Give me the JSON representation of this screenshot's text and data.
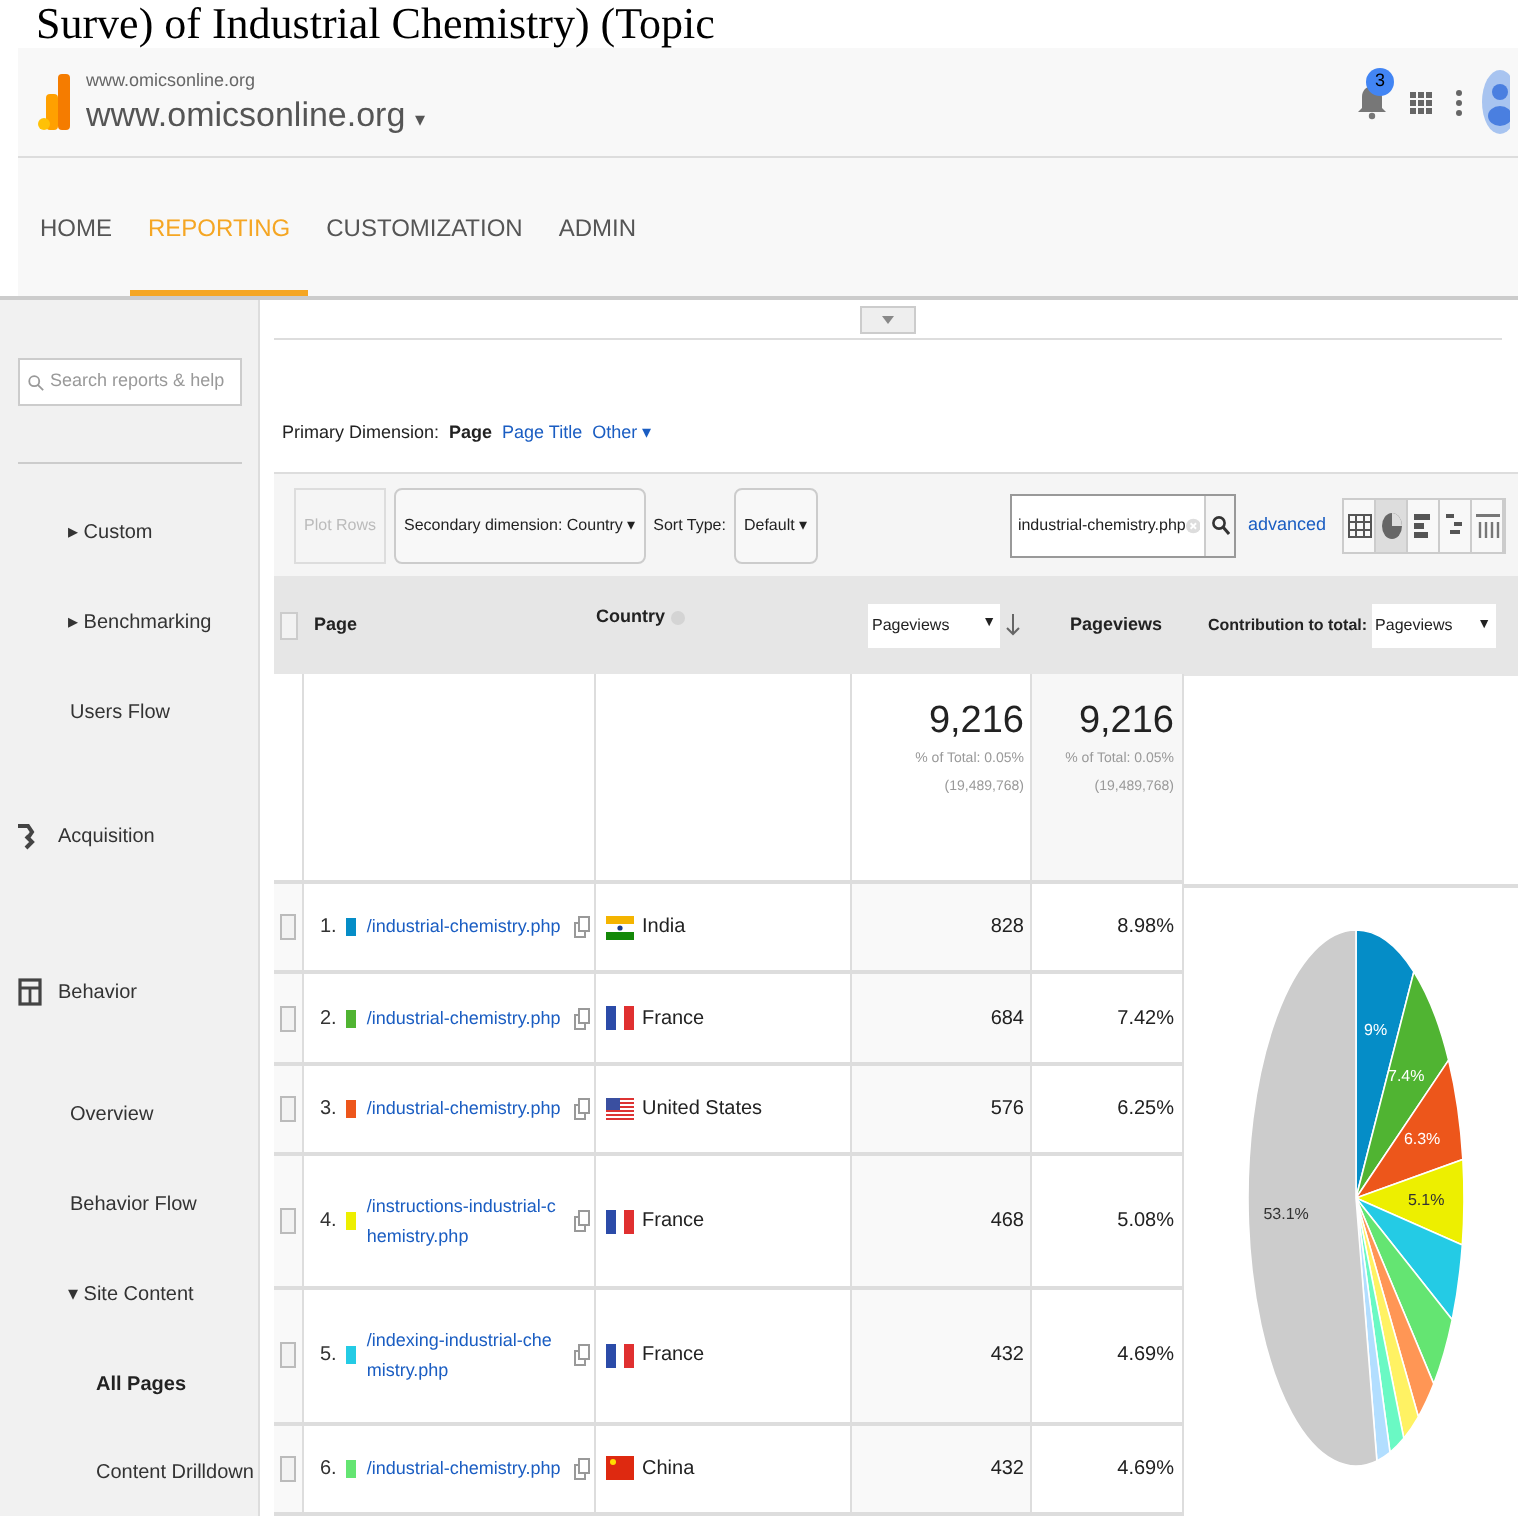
{
  "banner": {
    "title": "Surve) of Industrial Chemistry) (Topic"
  },
  "header": {
    "account": "www.omicsonline.org",
    "property": "www.omicsonline.org",
    "property_caret": "▾",
    "notifications": "3"
  },
  "nav": [
    {
      "label": "HOME",
      "selected": false
    },
    {
      "label": "REPORTING",
      "selected": true
    },
    {
      "label": "CUSTOMIZATION",
      "selected": false
    },
    {
      "label": "ADMIN",
      "selected": false
    }
  ],
  "sidebar": {
    "search_placeholder": "Search reports & help",
    "items": [
      {
        "kind": "expandable",
        "label": "Custom",
        "caret": "▸"
      },
      {
        "kind": "expandable",
        "label": "Benchmarking",
        "caret": "▸"
      },
      {
        "kind": "link",
        "label": "Users Flow",
        "selected": false
      },
      {
        "kind": "section",
        "label": "Acquisition"
      },
      {
        "kind": "section",
        "label": "Behavior"
      },
      {
        "kind": "link",
        "label": "Overview",
        "selected": false
      },
      {
        "kind": "link",
        "label": "Behavior Flow",
        "selected": false
      },
      {
        "kind": "expandable",
        "label": "Site Content",
        "caret": "▾"
      },
      {
        "kind": "sublink",
        "label": "All Pages",
        "selected": true
      },
      {
        "kind": "sublink",
        "label": "Content Drilldown",
        "selected": false
      }
    ]
  },
  "primary_dimension": {
    "label": "Primary Dimension:",
    "options": [
      {
        "label": "Page",
        "selected": true
      },
      {
        "label": "Page Title",
        "selected": false
      },
      {
        "label": "Other ▾",
        "selected": false
      }
    ]
  },
  "toolbar": {
    "plot_rows": {
      "label": "Plot Rows",
      "disabled": true
    },
    "secondary": "Secondary dimension: Country",
    "secondary_caret": "▾",
    "sort_label": "Sort Type:",
    "sort_value": "Default",
    "sort_caret": "▾",
    "filter_value": "industrial-chemistry.php",
    "advanced": "advanced",
    "views": [
      {
        "kind": "table",
        "selected": false
      },
      {
        "kind": "pie",
        "selected": true
      },
      {
        "kind": "performance",
        "selected": false
      },
      {
        "kind": "comparison",
        "selected": false
      },
      {
        "kind": "pivot",
        "selected": false
      }
    ]
  },
  "table": {
    "select_all_checked": false,
    "columns": {
      "page": "Page",
      "country": "Country",
      "metric_select": "Pageviews",
      "metric_select_caret": "▼",
      "metric": "Pageviews",
      "contribution_label": "Contribution to total:",
      "contribution_select": "Pageviews",
      "contribution_caret": "▼"
    },
    "totals": [
      {
        "value": "9,216",
        "share": "% of Total: 0.05%",
        "total": "(19,489,768)"
      },
      {
        "value": "9,216",
        "share": "% of Total: 0.05%",
        "total": "(19,489,768)"
      }
    ],
    "rows": [
      {
        "checked": false,
        "index": "1.",
        "color": "#058dc7",
        "page": "/industrial-chemistry.php",
        "country": {
          "name": "India",
          "kind": "india"
        },
        "pageviews": "828",
        "share": "8.98%"
      },
      {
        "checked": false,
        "index": "2.",
        "color": "#50b432",
        "page": "/industrial-chemistry.php",
        "country": {
          "name": "France",
          "kind": "france"
        },
        "pageviews": "684",
        "share": "7.42%"
      },
      {
        "checked": false,
        "index": "3.",
        "color": "#ed561b",
        "page": "/industrial-chemistry.php",
        "country": {
          "name": "United States",
          "kind": "usa"
        },
        "pageviews": "576",
        "share": "6.25%"
      },
      {
        "checked": false,
        "index": "4.",
        "color": "#edef00",
        "page": "/instructions-industrial-chemistry.php",
        "country": {
          "name": "France",
          "kind": "france"
        },
        "pageviews": "468",
        "share": "5.08%"
      },
      {
        "checked": false,
        "index": "5.",
        "color": "#24cbe5",
        "page": "/indexing-industrial-chemistry.php",
        "country": {
          "name": "France",
          "kind": "france"
        },
        "pageviews": "432",
        "share": "4.69%"
      },
      {
        "checked": false,
        "index": "6.",
        "color": "#64e572",
        "page": "/industrial-chemistry.php",
        "country": {
          "name": "China",
          "kind": "china"
        },
        "pageviews": "432",
        "share": "4.69%"
      }
    ],
    "pie_labels": [
      "9%",
      "7.4%",
      "6.3%",
      "5.1%",
      "53.1%"
    ]
  }
}
